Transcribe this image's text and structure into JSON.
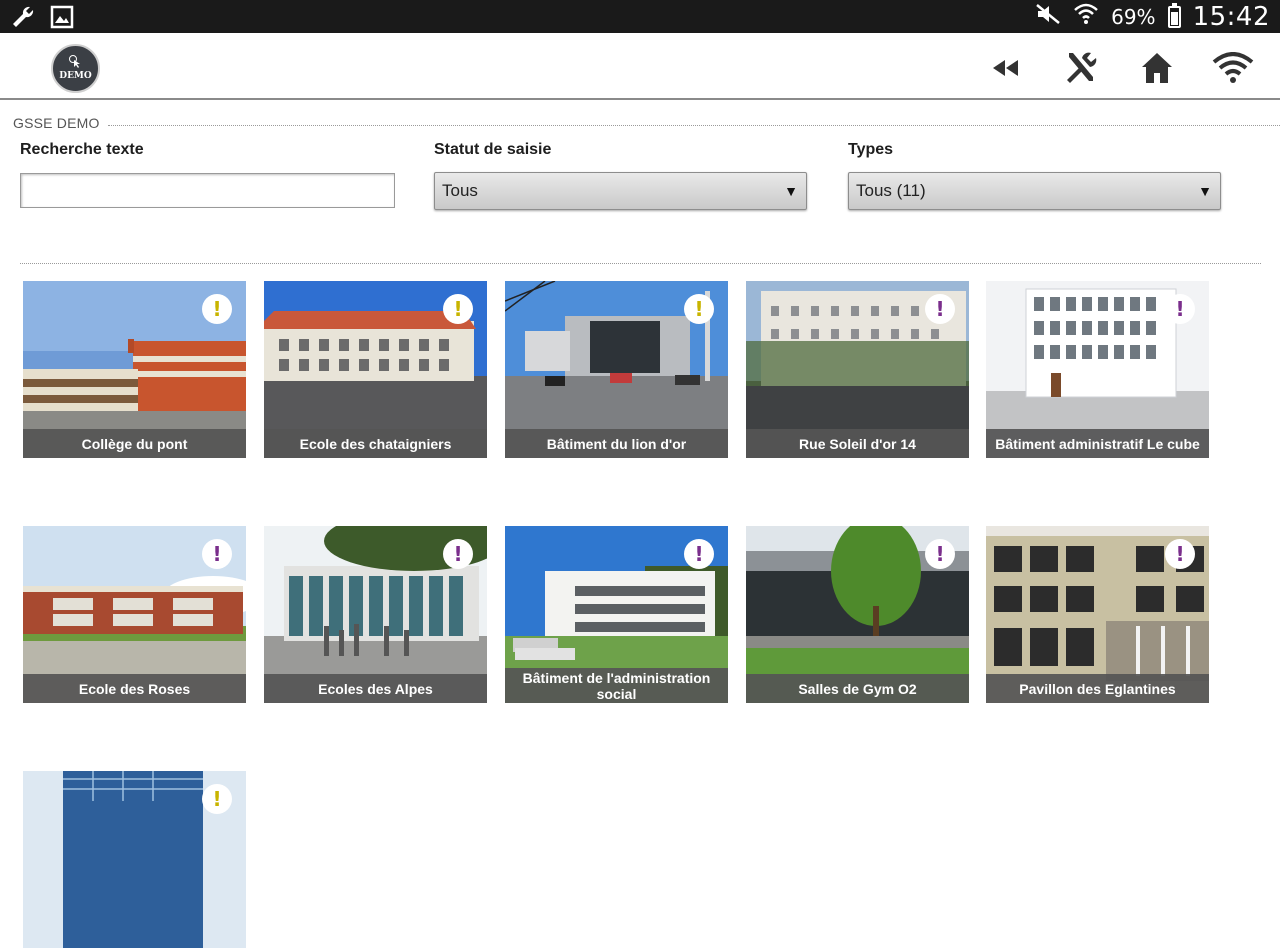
{
  "status_bar": {
    "battery_level": 0.69,
    "battery_text": "69%",
    "clock": "15:42",
    "left_icons": [
      "wrench-icon",
      "image-icon"
    ],
    "right_icons": [
      "mute-icon",
      "wifi-icon",
      "battery-icon"
    ]
  },
  "header": {
    "logo_text": "DEMO",
    "actions": [
      {
        "name": "rewind-button",
        "icon": "rewind-icon"
      },
      {
        "name": "tools-button",
        "icon": "tools-icon"
      },
      {
        "name": "home-button",
        "icon": "home-icon"
      },
      {
        "name": "wifi-button",
        "icon": "wifi-icon"
      }
    ]
  },
  "section": {
    "title": "GSSE DEMO"
  },
  "filters": {
    "search": {
      "label": "Recherche texte",
      "value": "",
      "placeholder": ""
    },
    "status": {
      "label": "Statut de saisie",
      "selected": "Tous"
    },
    "types": {
      "label": "Types",
      "selected": "Tous (11)"
    }
  },
  "colors": {
    "warning_yellow": "#c8b400",
    "warning_purple": "#7a2e8c",
    "caption_bg": "#555555"
  },
  "buildings": [
    {
      "title": "Collège du pont",
      "status": "yellow",
      "scene": "college"
    },
    {
      "title": "Ecole des chataigniers",
      "status": "yellow",
      "scene": "chataigniers"
    },
    {
      "title": "Bâtiment du lion d'or",
      "status": "yellow",
      "scene": "lion"
    },
    {
      "title": "Rue Soleil d'or 14",
      "status": "purple",
      "scene": "soleil"
    },
    {
      "title": "Bâtiment administratif Le cube",
      "status": "purple",
      "scene": "cube"
    },
    {
      "title": "Ecole des Roses",
      "status": "purple",
      "scene": "roses"
    },
    {
      "title": "Ecoles des Alpes",
      "status": "purple",
      "scene": "alpes"
    },
    {
      "title": "Bâtiment de l'administration social",
      "status": "purple",
      "scene": "admin"
    },
    {
      "title": "Salles de Gym O2",
      "status": "purple",
      "scene": "gym"
    },
    {
      "title": "Pavillon des Eglantines",
      "status": "purple",
      "scene": "eglantines"
    },
    {
      "title": "",
      "status": "yellow",
      "scene": "glass"
    }
  ]
}
